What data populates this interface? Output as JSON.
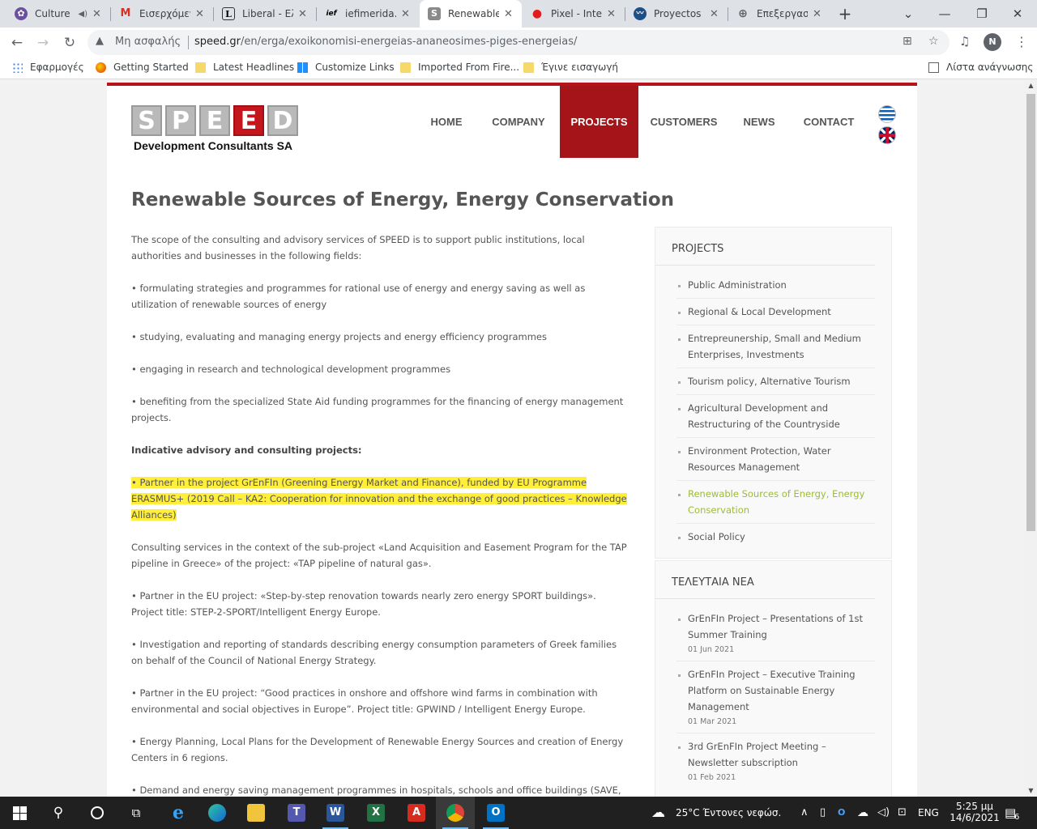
{
  "browser": {
    "tabs": [
      {
        "title": "Culture",
        "muted": true
      },
      {
        "title": "Εισερχόμενα"
      },
      {
        "title": "Liberal - Ελλ"
      },
      {
        "title": "iefimerida.g"
      },
      {
        "title": "Renewable"
      },
      {
        "title": "Pixel - Inter"
      },
      {
        "title": "Proyectos I"
      },
      {
        "title": "Επεξεργασί"
      }
    ],
    "new_tab": "+",
    "address": {
      "security_label": "Μη ασφαλής",
      "host": "speed.gr",
      "path": "/en/erga/exoikonomisi-energeias-ananeosimes-piges-energeias/"
    },
    "profile_initial": "N",
    "bookmarks": [
      "Εφαρμογές",
      "Getting Started",
      "Latest Headlines",
      "Customize Links",
      "Imported From Fire...",
      "Έγινε εισαγωγή"
    ],
    "reading_list": "Λίστα ανάγνωσης"
  },
  "site": {
    "logo": {
      "letters": [
        "S",
        "P",
        "E",
        "E",
        "D"
      ],
      "subtitle": "Development Consultants SA"
    },
    "nav": [
      "HOME",
      "COMPANY",
      "PROJECTS",
      "CUSTOMERS",
      "NEWS",
      "CONTACT"
    ],
    "active_nav": "PROJECTS"
  },
  "content": {
    "title": "Renewable Sources of Energy, Energy Conservation",
    "paragraphs": [
      "The scope of the consulting and advisory services of SPEED is to support public institutions, local authorities and businesses in the following fields:",
      "• formulating strategies and programmes for rational use of energy and energy saving as well as utilization of renewable sources of energy",
      "• studying, evaluating and managing energy projects and energy efficiency programmes",
      "• engaging in research and technological development programmes",
      "• benefiting from the specialized State Aid funding programmes for the financing of energy management projects.",
      "Indicative advisory and consulting projects:",
      "• Partner in the project GrEnFIn (Greening Energy Market and Finance), funded by EU Programme ERASMUS+ (2019 Call – KA2: Cooperation for innovation and the exchange of good practices – Knowledge Alliances)",
      "Consulting services in the context of the sub-project «Land Acquisition and Easement Program for the TAP pipeline in Greece» of the project: «TAP pipeline of natural gas».",
      "• Partner in the EU project: «Step-by-step renovation towards nearly zero energy SPORT buildings». Project title: STEP-2-SPORT/Intelligent Energy Europe.",
      "• Investigation and reporting of standards describing energy consumption parameters of Greek families on behalf of the Council of National Energy Strategy.",
      "• Partner in the EU project: “Good practices in onshore and offshore wind farms in combination with environmental and social objectives in Europe”. Project title: GPWIND / Intelligent Energy Europe.",
      "• Energy Planning, Local Plans for the Development of Renewable Energy Sources and creation of Energy Centers in 6 regions.",
      "• Demand and energy saving management programmes in hospitals, schools and office buildings (SAVE, ECOS OVERTURE)."
    ]
  },
  "sidebar": {
    "projects": {
      "title": "PROJECTS",
      "items": [
        "Public Administration",
        "Regional & Local Development",
        "Entrepreunership, Small and Medium Enterprises, Investments",
        "Tourism policy, Alternative Tourism",
        "Agricultural Development and Restructuring of the Countryside",
        "Environment Protection, Water Resources Management",
        "Renewable Sources of Energy, Energy Conservation",
        "Social Policy"
      ]
    },
    "news": {
      "title": "ΤΕΛΕΥΤΑΙΑ ΝΕΑ",
      "items": [
        {
          "title": "GrEnFIn Project – Presentations of 1st Summer Training",
          "date": "01 Jun 2021"
        },
        {
          "title": "GrEnFIn Project – Executive Training Platform on Sustainable Energy Management",
          "date": "01 Mar 2021"
        },
        {
          "title": "3rd GrEnFIn Project Meeting – Newsletter subscription",
          "date": "01 Feb 2021"
        }
      ]
    }
  },
  "taskbar": {
    "weather": "25°C  Έντονες νεφώσ.",
    "language": "ENG",
    "time": "5:25 μμ",
    "date": "14/6/2021",
    "notifications": "6"
  }
}
